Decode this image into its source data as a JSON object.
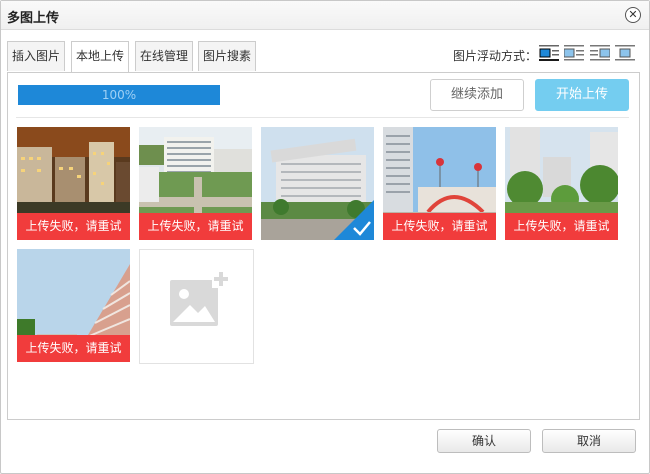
{
  "dialog": {
    "title": "多图上传",
    "close_glyph": "✕"
  },
  "tabs": [
    {
      "label": "插入图片",
      "active": false
    },
    {
      "label": "本地上传",
      "active": true
    },
    {
      "label": "在线管理",
      "active": false
    },
    {
      "label": "图片搜素",
      "active": false
    }
  ],
  "float": {
    "label": "图片浮动方式：",
    "options": [
      "align-none-icon",
      "align-left-icon",
      "align-right-icon",
      "align-center-icon"
    ]
  },
  "upload": {
    "progress_text": "100%",
    "progress_value": 1.0,
    "add_button": "继续添加",
    "start_button": "开始上传"
  },
  "images": [
    {
      "status_text": "上传失败，请重试",
      "failed": true,
      "scene": "night-buildings"
    },
    {
      "status_text": "上传失败，请重试",
      "failed": true,
      "scene": "campus-aerial"
    },
    {
      "status_text": "",
      "failed": false,
      "selected": true,
      "scene": "gate-building"
    },
    {
      "status_text": "上传失败，请重试",
      "failed": true,
      "scene": "sky-towers"
    },
    {
      "status_text": "上传失败，请重试",
      "failed": true,
      "scene": "trees-buildings"
    },
    {
      "status_text": "上传失败，请重试",
      "failed": true,
      "scene": "pink-building"
    }
  ],
  "footer": {
    "ok": "确认",
    "cancel": "取消"
  },
  "colors": {
    "progress": "#1e88d8",
    "start_button": "#74cdf0",
    "error_bar": "#f13c3c",
    "check_badge": "#1e88d8"
  }
}
